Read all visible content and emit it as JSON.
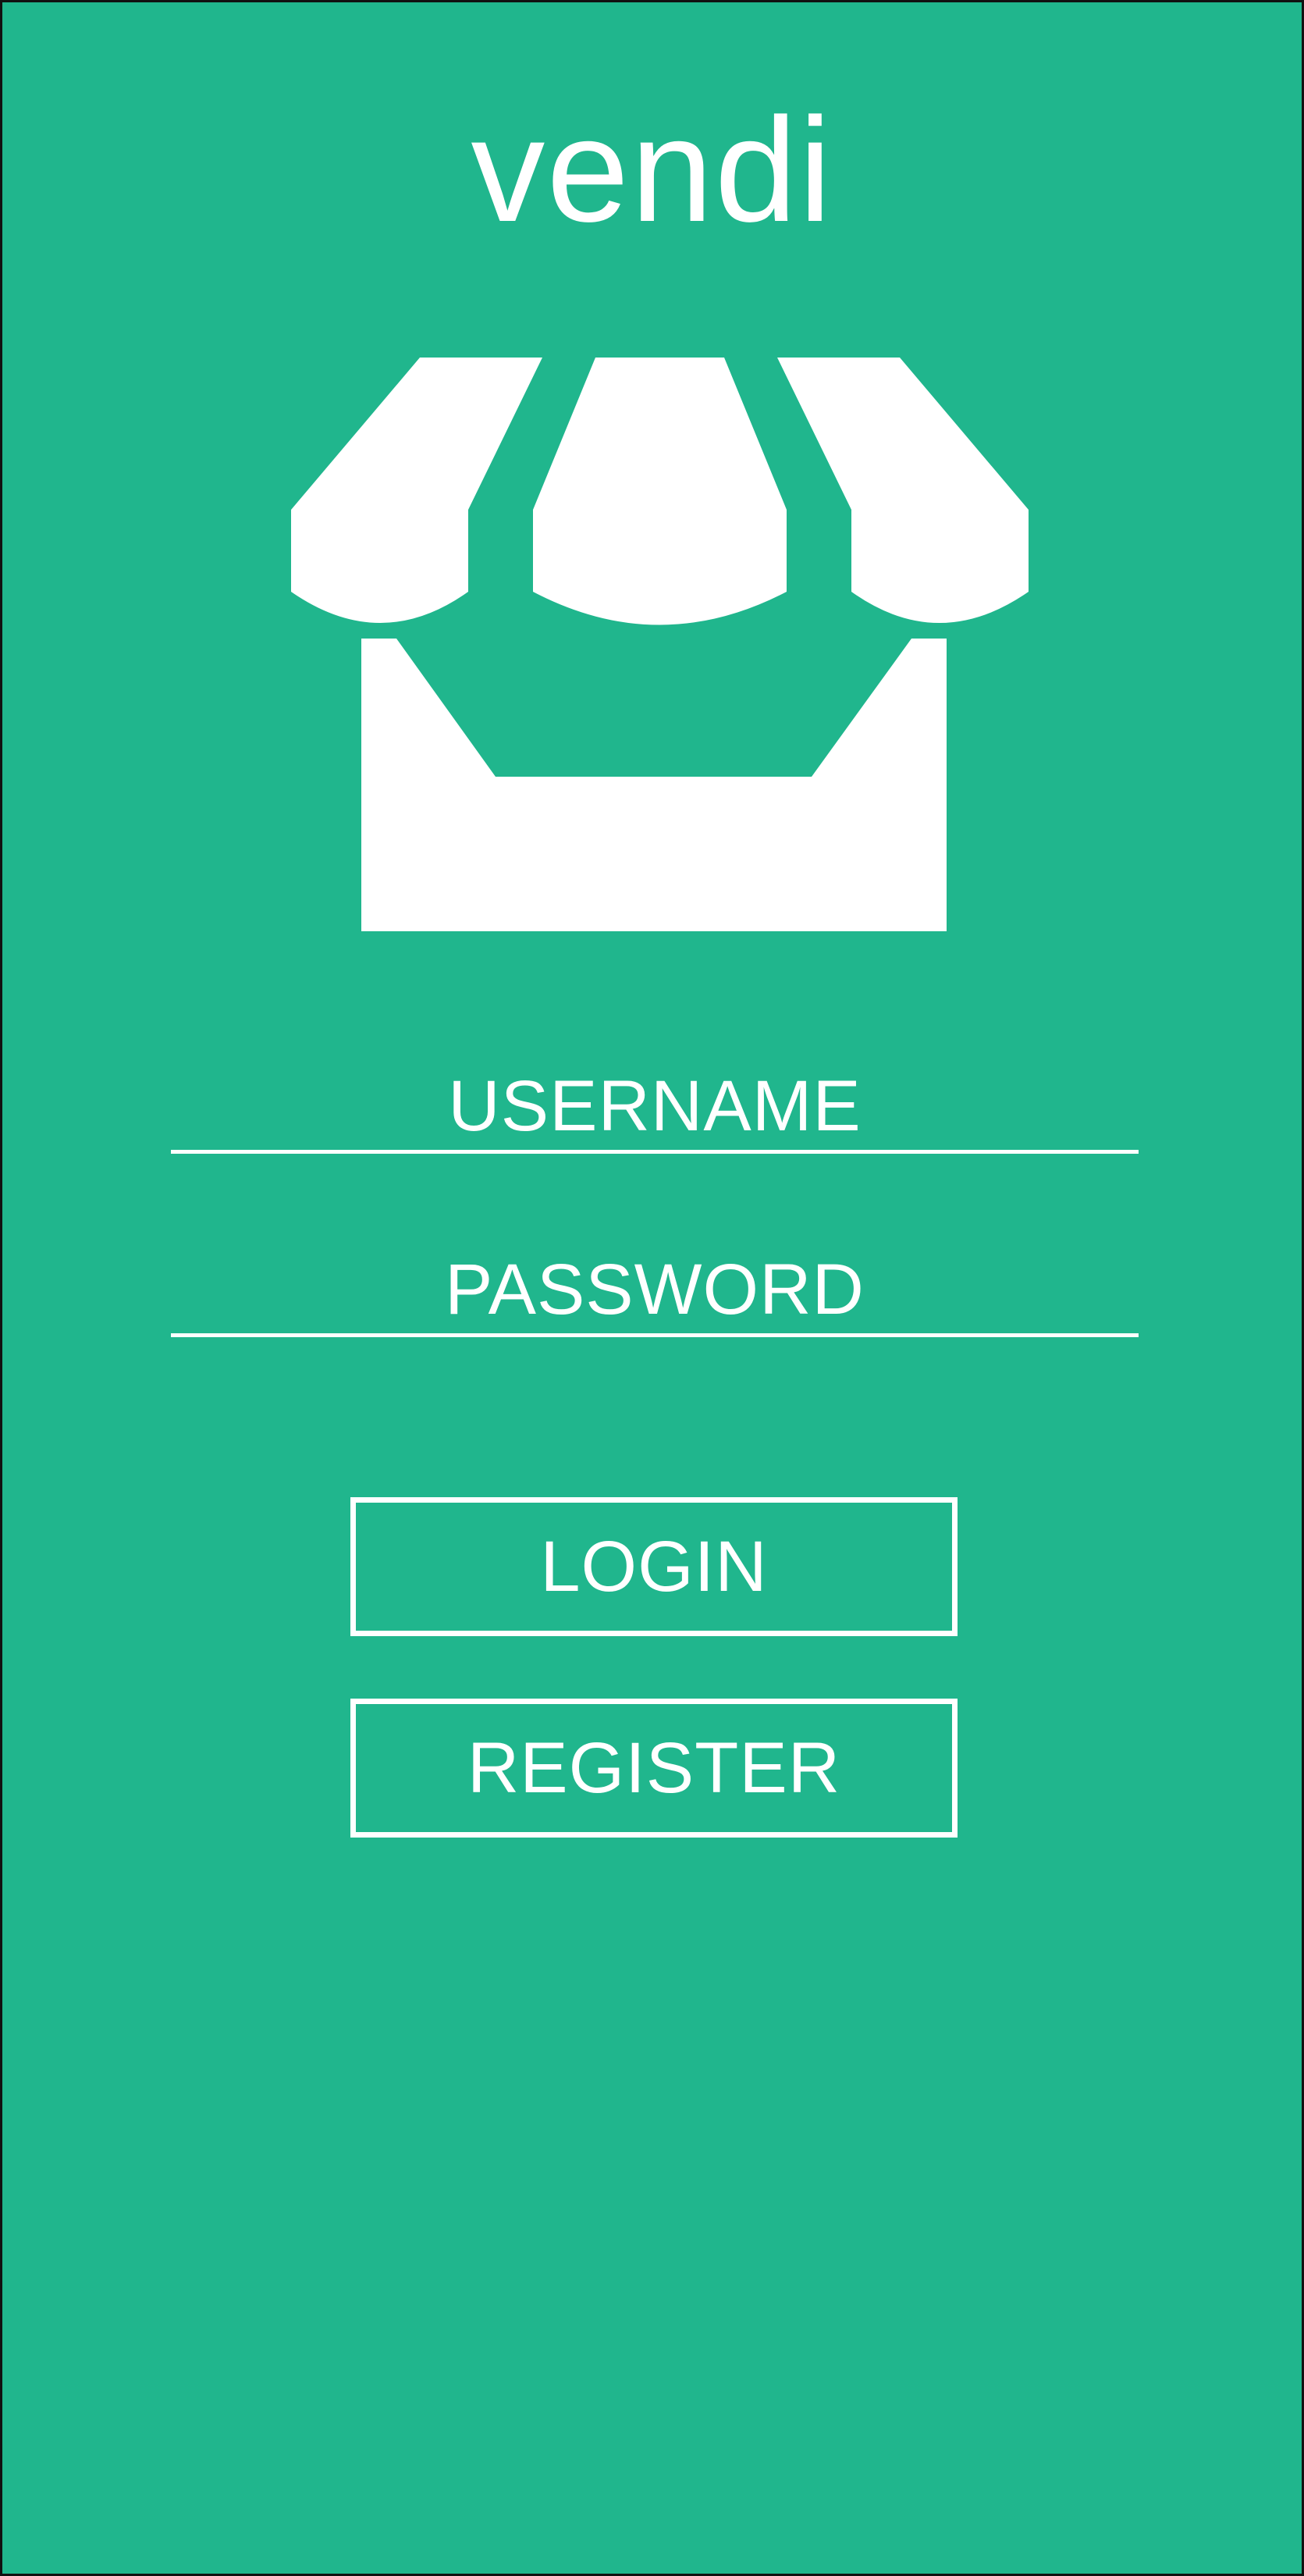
{
  "app": {
    "title": "vendi",
    "logo_icon": "storefront-awning-icon"
  },
  "form": {
    "username_placeholder": "USERNAME",
    "username_value": "",
    "password_placeholder": "PASSWORD",
    "password_value": "",
    "login_label": "LOGIN",
    "register_label": "REGISTER"
  },
  "colors": {
    "background": "#20b68d",
    "foreground": "#ffffff",
    "frame_border": "#111111"
  }
}
